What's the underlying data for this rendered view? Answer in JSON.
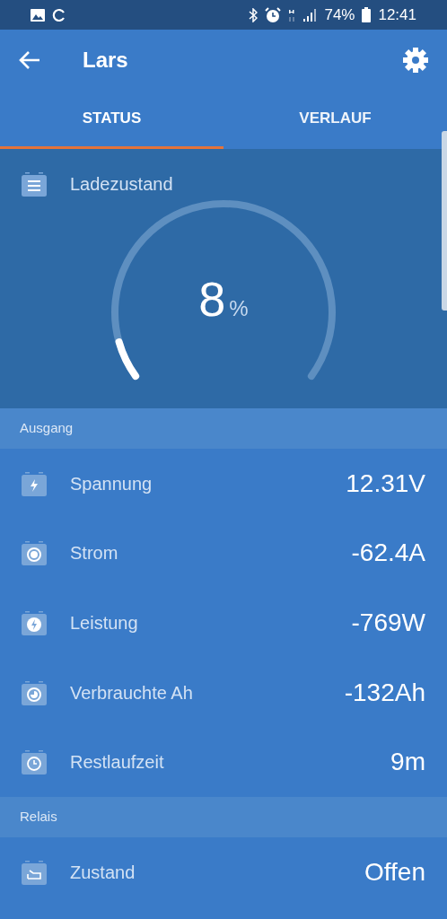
{
  "status_bar": {
    "battery": "74%",
    "time": "12:41"
  },
  "app_bar": {
    "title": "Lars"
  },
  "tabs": [
    {
      "label": "STATUS",
      "selected": true
    },
    {
      "label": "VERLAUF",
      "selected": false
    }
  ],
  "charge": {
    "label": "Ladezustand",
    "value": "8",
    "unit": "%"
  },
  "sections": [
    {
      "title": "Ausgang",
      "rows": [
        {
          "label": "Spannung",
          "value": "12.31V"
        },
        {
          "label": "Strom",
          "value": "-62.4A"
        },
        {
          "label": "Leistung",
          "value": "-769W"
        },
        {
          "label": "Verbrauchte Ah",
          "value": "-132Ah"
        },
        {
          "label": "Restlaufzeit",
          "value": "9m"
        }
      ]
    },
    {
      "title": "Relais",
      "rows": [
        {
          "label": "Zustand",
          "value": "Offen"
        }
      ]
    }
  ]
}
